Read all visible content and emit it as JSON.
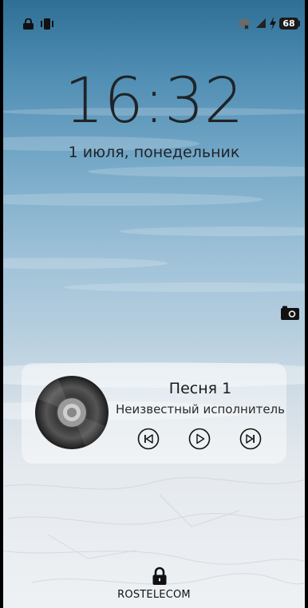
{
  "status_bar": {
    "icons": [
      "lock-icon",
      "vibrate-icon",
      "wifi-icon",
      "cell-signal-icon",
      "charging-icon",
      "battery-icon"
    ],
    "battery_level": "68"
  },
  "lockscreen": {
    "time": "16:32",
    "date": "1 июля, понедельник",
    "carrier": "ROSTELECOM"
  },
  "media": {
    "title": "Песня 1",
    "artist": "Неизвестный исполнитель",
    "controls": [
      "previous-icon",
      "play-icon",
      "next-icon"
    ]
  },
  "colors": {
    "text": "#1f2428",
    "card_bg": "rgba(255,255,255,0.45)",
    "sky_top": "#2f6f96",
    "snow": "#eef1f4"
  }
}
